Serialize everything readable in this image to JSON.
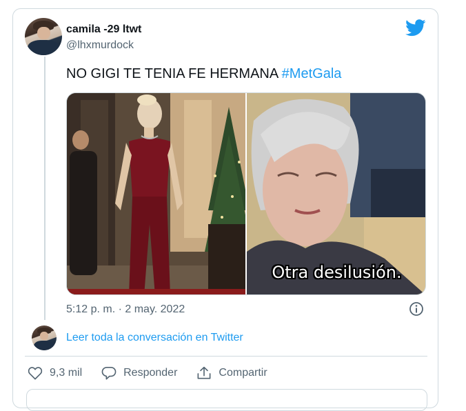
{
  "tweet": {
    "author_name": "camila -29 ltwt",
    "author_handle": "@lhxmurdock",
    "text": "NO GIGI TE TENIA FE HERMANA",
    "hashtag": "#MetGala",
    "media_subtitle": "Otra desilusión.",
    "timestamp": "5:12 p. m. · 2 may. 2022",
    "read_conversation_link": "Leer toda la conversación en Twitter"
  },
  "actions": {
    "like_count": "9,3 mil",
    "reply_label": "Responder",
    "share_label": "Compartir"
  },
  "icons": [
    "twitter-bird-icon",
    "info-icon",
    "heart-icon",
    "reply-bubble-icon",
    "share-icon"
  ],
  "colors": {
    "accent": "#1d9bf0",
    "secondary_text": "#536471",
    "border": "#cfd9de"
  }
}
